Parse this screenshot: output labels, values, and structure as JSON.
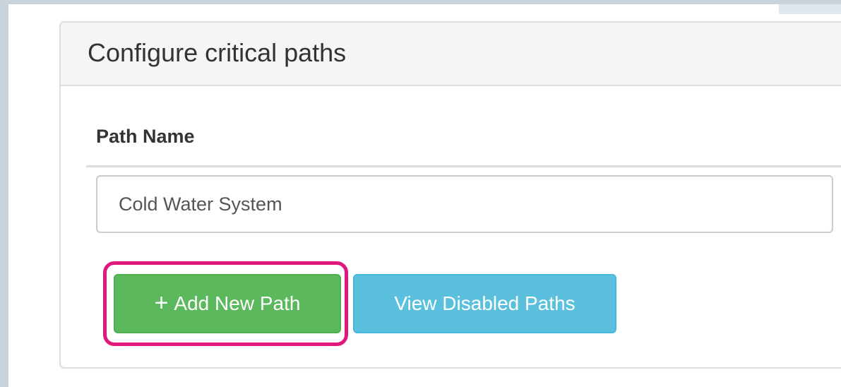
{
  "panel": {
    "title": "Configure critical paths"
  },
  "table": {
    "column_header": "Path Name",
    "rows": [
      {
        "path_name": "Cold Water System"
      }
    ]
  },
  "actions": {
    "add_icon": "+",
    "add_label": "Add New Path",
    "view_disabled_label": "View Disabled Paths"
  },
  "colors": {
    "success_green": "#5cb85c",
    "info_blue": "#5bc0de",
    "highlight_magenta": "#e0177c"
  }
}
